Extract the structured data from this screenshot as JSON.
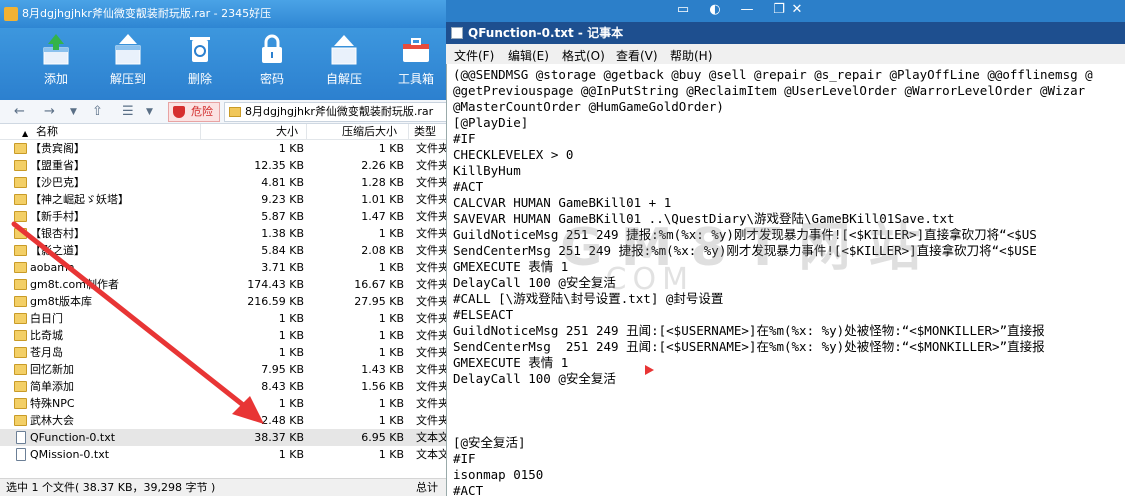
{
  "archive_window": {
    "title": "8月dgjhgjhkr斧仙微变靓装耐玩版.rar - 2345好压",
    "toolbar": [
      {
        "label": "添加",
        "icon": "add-icon"
      },
      {
        "label": "解压到",
        "icon": "extract-to-icon"
      },
      {
        "label": "删除",
        "icon": "trash-icon"
      },
      {
        "label": "密码",
        "icon": "lock-icon"
      },
      {
        "label": "自解压",
        "icon": "self-extract-icon"
      },
      {
        "label": "工具箱",
        "icon": "toolbox-icon"
      }
    ],
    "danger_label": "危险",
    "path": "8月dgjhgjhkr斧仙微变靓装耐玩版.rar",
    "columns": {
      "name": "名称",
      "size": "大小",
      "packed": "压缩后大小",
      "type": "类型"
    },
    "rows": [
      {
        "name": "【贵宾阁】",
        "size": "1 KB",
        "packed": "1 KB",
        "type": "文件夹",
        "kind": "folder"
      },
      {
        "name": "【盟重省】",
        "size": "12.35 KB",
        "packed": "2.26 KB",
        "type": "文件夹",
        "kind": "folder"
      },
      {
        "name": "【沙巴克】",
        "size": "4.81 KB",
        "packed": "1.28 KB",
        "type": "文件夹",
        "kind": "folder"
      },
      {
        "name": "【神之崛起ゞ妖塔】",
        "size": "9.23 KB",
        "packed": "1.01 KB",
        "type": "文件夹",
        "kind": "folder"
      },
      {
        "name": "【新手村】",
        "size": "5.87 KB",
        "packed": "1.47 KB",
        "type": "文件夹",
        "kind": "folder"
      },
      {
        "name": "【银杏村】",
        "size": "1.38 KB",
        "packed": "1 KB",
        "type": "文件夹",
        "kind": "folder"
      },
      {
        "name": "【影之道】",
        "size": "5.84 KB",
        "packed": "2.08 KB",
        "type": "文件夹",
        "kind": "folder"
      },
      {
        "name": "aobama",
        "size": "3.71 KB",
        "packed": "1 KB",
        "type": "文件夹",
        "kind": "folder"
      },
      {
        "name": "gm8t.com制作者",
        "size": "174.43 KB",
        "packed": "16.67 KB",
        "type": "文件夹",
        "kind": "folder"
      },
      {
        "name": "gm8t版本库",
        "size": "216.59 KB",
        "packed": "27.95 KB",
        "type": "文件夹",
        "kind": "folder"
      },
      {
        "name": "白日门",
        "size": "1 KB",
        "packed": "1 KB",
        "type": "文件夹",
        "kind": "folder"
      },
      {
        "name": "比奇城",
        "size": "1 KB",
        "packed": "1 KB",
        "type": "文件夹",
        "kind": "folder"
      },
      {
        "name": "苍月岛",
        "size": "1 KB",
        "packed": "1 KB",
        "type": "文件夹",
        "kind": "folder"
      },
      {
        "name": "回忆新加",
        "size": "7.95 KB",
        "packed": "1.43 KB",
        "type": "文件夹",
        "kind": "folder"
      },
      {
        "name": "简单添加",
        "size": "8.43 KB",
        "packed": "1.56 KB",
        "type": "文件夹",
        "kind": "folder"
      },
      {
        "name": "特殊NPC",
        "size": "1 KB",
        "packed": "1 KB",
        "type": "文件夹",
        "kind": "folder"
      },
      {
        "name": "武林大会",
        "size": "2.48 KB",
        "packed": "1 KB",
        "type": "文件夹",
        "kind": "folder"
      },
      {
        "name": "QFunction-0.txt",
        "size": "38.37 KB",
        "packed": "6.95 KB",
        "type": "文本文",
        "kind": "txt",
        "selected": true
      },
      {
        "name": "QMission-0.txt",
        "size": "1 KB",
        "packed": "1 KB",
        "type": "文本文",
        "kind": "txt"
      }
    ],
    "status": "选中 1 个文件( 38.37 KB，39,298 字节 )",
    "status_total": "总计"
  },
  "notepad": {
    "title": "QFunction-0.txt - 记事本",
    "menu": [
      "文件(F)",
      "编辑(E)",
      "格式(O)",
      "查看(V)",
      "帮助(H)"
    ],
    "lines": [
      "(@@SENDMSG @storage @getback @buy @sell @repair @s_repair @PlayOffLine @@offlinemsg @",
      "@getPreviouspage @@InPutString @ReclaimItem @UserLevelOrder @WarrorLevelOrder @Wizar",
      "@MasterCountOrder @HumGameGoldOrder)",
      "[@PlayDie]",
      "#IF",
      "CHECKLEVELEX > 0",
      "KillByHum",
      "#ACT",
      "CALCVAR HUMAN GameBKill01 + 1",
      "SAVEVAR HUMAN GameBKill01 ..\\QuestDiary\\游戏登陆\\GameBKill01Save.txt",
      "GuildNoticeMsg 251 249 捷报:%m(%x: %y)刚才发现暴力事件![<$KILLER>]直接拿砍刀将“<$US",
      "SendCenterMsg 251 249 捷报:%m(%x: %y)刚才发现暴力事件![<$KILLER>]直接拿砍刀将“<$USE",
      "GMEXECUTE 表情 1",
      "DelayCall 100 @安全复活",
      "#CALL [\\游戏登陆\\封号设置.txt] @封号设置",
      "#ELSEACT",
      "GuildNoticeMsg 251 249 丑闻:[<$USERNAME>]在%m(%x: %y)处被怪物:“<$MONKILLER>”直接报",
      "SendCenterMsg  251 249 丑闻:[<$USERNAME>]在%m(%x: %y)处被怪物:“<$MONKILLER>”直接报",
      "GMEXECUTE 表情 1",
      "DelayCall 100 @安全复活",
      "",
      "",
      "",
      "[@安全复活]",
      "#IF",
      "isonmap 0150",
      "#ACT"
    ]
  }
}
